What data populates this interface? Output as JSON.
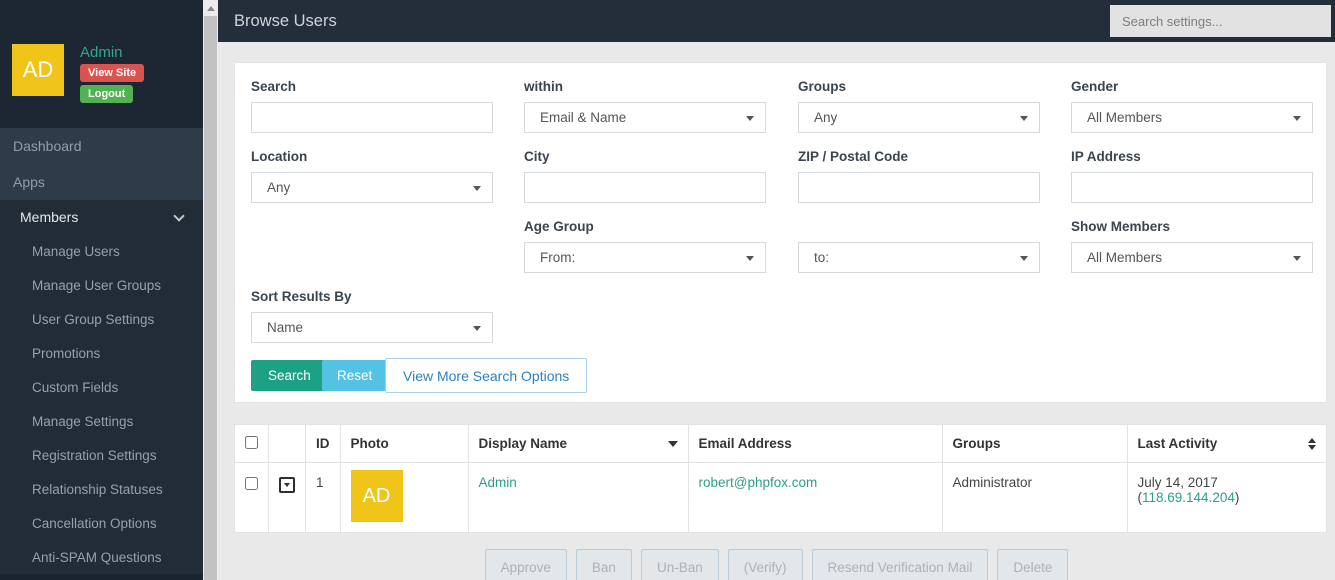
{
  "sidebar": {
    "avatar_initials": "AD",
    "username": "Admin",
    "view_site_label": "View Site",
    "logout_label": "Logout",
    "items": [
      {
        "label": "Dashboard"
      },
      {
        "label": "Apps"
      },
      {
        "label": "Members"
      }
    ],
    "submenu": [
      "Manage Users",
      "Manage User Groups",
      "User Group Settings",
      "Promotions",
      "Custom Fields",
      "Manage Settings",
      "Registration Settings",
      "Relationship Statuses",
      "Cancellation Options",
      "Anti-SPAM Questions"
    ]
  },
  "header": {
    "title": "Browse Users",
    "search_placeholder": "Search settings..."
  },
  "filters": {
    "search_label": "Search",
    "search_value": "",
    "within_label": "within",
    "within_value": "Email & Name",
    "groups_label": "Groups",
    "groups_value": "Any",
    "gender_label": "Gender",
    "gender_value": "All Members",
    "location_label": "Location",
    "location_value": "Any",
    "city_label": "City",
    "city_value": "",
    "zip_label": "ZIP / Postal Code",
    "zip_value": "",
    "ip_label": "IP Address",
    "ip_value": "",
    "age_group_label": "Age Group",
    "age_from_value": "From:",
    "age_to_value": "to:",
    "show_members_label": "Show Members",
    "show_members_value": "All Members",
    "sort_label": "Sort Results By",
    "sort_value": "Name",
    "search_button": "Search",
    "reset_button": "Reset",
    "more_options_button": "View More Search Options"
  },
  "table": {
    "headers": [
      "ID",
      "Photo",
      "Display Name",
      "Email Address",
      "Groups",
      "Last Activity"
    ],
    "rows": [
      {
        "id": "1",
        "photo_initials": "AD",
        "display_name": "Admin",
        "email": "robert@phpfox.com",
        "groups": "Administrator",
        "last_activity_date": "July 14, 2017",
        "paren_open": "(",
        "ip": "118.69.144.204",
        "paren_close": ")"
      }
    ]
  },
  "actions": {
    "buttons": [
      "Approve",
      "Ban",
      "Un-Ban",
      "(Verify)",
      "Resend Verification Mail",
      "Delete"
    ]
  },
  "colors": {
    "accent_teal": "#2b9e8c",
    "avatar_yellow": "#f0c419",
    "view_site_red": "#d9534f",
    "logout_green": "#52b152",
    "search_btn_green": "#1ca185",
    "reset_btn_blue": "#54c2e2",
    "more_btn_blue": "#2b80c4",
    "sidebar_dark": "#1d2733",
    "sidebar_light": "#2e3b49",
    "header_dark": "#232e3a"
  }
}
